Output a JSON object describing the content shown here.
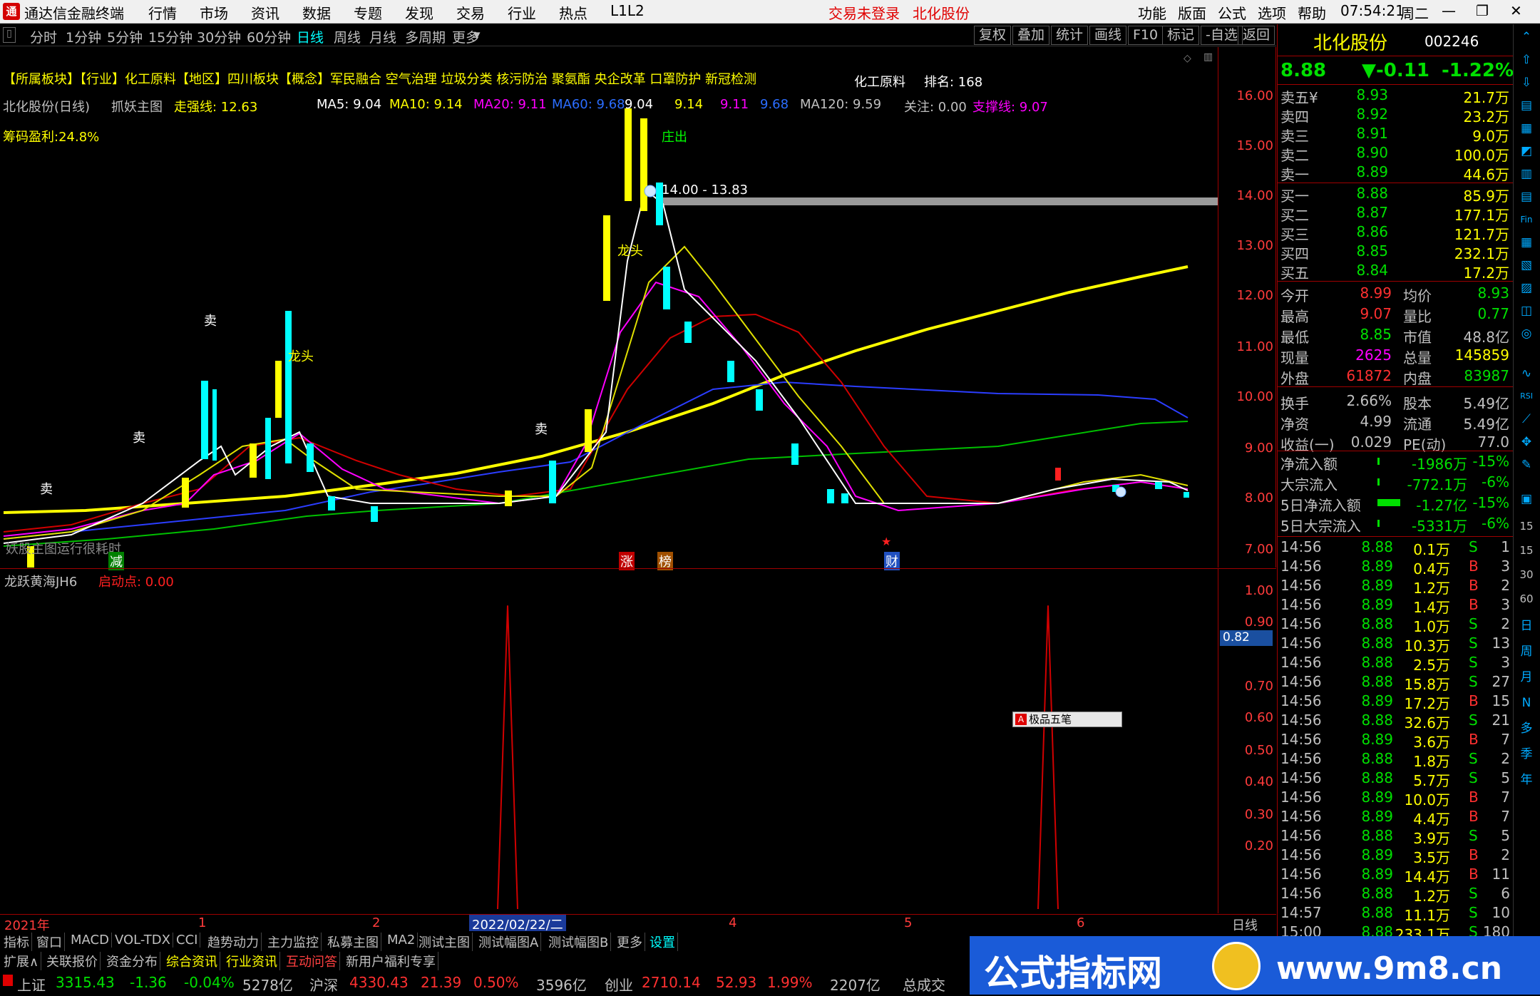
{
  "titlebar": {
    "app_name": "通达信金融终端",
    "menus": [
      "行情",
      "市场",
      "资讯",
      "数据",
      "专题",
      "发现",
      "交易",
      "行业",
      "热点",
      "L1L2"
    ],
    "login_status": "交易未登录",
    "stock_name": "北化股份",
    "right_menus": [
      "功能",
      "版面",
      "公式",
      "选项",
      "帮助"
    ],
    "time": "07:54:21",
    "weekday": "周二"
  },
  "periods": [
    "分时",
    "1分钟",
    "5分钟",
    "15分钟",
    "30分钟",
    "60分钟",
    "日线",
    "周线",
    "月线",
    "多周期",
    "更多"
  ],
  "selected_period": "日线",
  "toolbar_buttons": [
    "复权",
    "叠加",
    "统计",
    "画线",
    "F10",
    "标记",
    "-自选",
    "返回"
  ],
  "chart_header": {
    "title": "北化股份(日线)",
    "main_indicator": "抓妖主图",
    "zqx_label": "走强线: 12.63",
    "ma5": "MA5: 9.04",
    "ma10": "MA10: 9.14",
    "ma20": "MA20: 9.11",
    "ma60": "MA60: 9.68",
    "v1": "9.04",
    "v2": "9.14",
    "v3": "9.11",
    "v4": "9.68",
    "ma120": "MA120: 9.59",
    "guanzhu": "关注: 0.00",
    "zhicheng": "支撑线: 9.07"
  },
  "concepts": "【所属板块】【行业】化工原料【地区】四川板块【概念】军民融合 空气治理 垃圾分类 核污防治 聚氨酯 央企改革 口罩防护 新冠检测",
  "industry": "化工原料",
  "rank": "排名: 168",
  "chip_profit": "筹码盈利:24.8%",
  "zone_label": "14.00 - 13.83",
  "annotations": {
    "sell": "卖",
    "dragon_head": "龙头",
    "zhuang_out": "庄出",
    "jian": "减",
    "zhang": "涨",
    "bang": "榜",
    "cai": "财",
    "bottom_note": "妖股主图运行很耗时"
  },
  "y_axis_main": [
    "16.00",
    "15.00",
    "14.00",
    "13.00",
    "12.00",
    "11.00",
    "10.00",
    "9.00",
    "8.00",
    "7.00"
  ],
  "sub_chart": {
    "title": "龙跃黄海JH6",
    "start_label": "启动点: 0.00",
    "y_axis": [
      "1.00",
      "0.90",
      "0.80",
      "0.70",
      "0.60",
      "0.50",
      "0.40",
      "0.30",
      "0.20"
    ],
    "current_value": "0.82",
    "ime_popup": "极品五笔"
  },
  "chart_data": {
    "type": "line",
    "title": "龙跃黄海JH6",
    "ylim": [
      0,
      1.05
    ],
    "series": [
      {
        "name": "启动点",
        "peaks_at_dates": [
          "2022/02/22",
          "2022/06"
        ],
        "values": [
          0,
          1,
          0,
          1,
          0
        ]
      }
    ]
  },
  "date_axis": {
    "year": "2021年",
    "m1": "1",
    "m2": "2",
    "highlight": "2022/02/22/二",
    "m4": "4",
    "m5": "5",
    "m6": "6",
    "right": "日线"
  },
  "bottom_tabs": [
    "指标",
    "窗口",
    "MACD",
    "VOL-TDX",
    "CCI",
    "趋势动力",
    "主力监控",
    "私募主图",
    "MA2",
    "测试主图",
    "测试幅图A",
    "测试幅图B",
    "更多",
    "设置"
  ],
  "bottom_tabs2": [
    "扩展∧",
    "关联报价",
    "资金分布",
    "综合资讯",
    "行业资讯",
    "互动问答",
    "新用户福利专享"
  ],
  "status": {
    "sh_label": "上证",
    "sh_val": "3315.43",
    "sh_chg": "-1.36",
    "sh_pct": "-0.04%",
    "sh_amt": "5278亿",
    "hs_label": "沪深",
    "hs_val": "4330.43",
    "hs_chg": "21.39",
    "hs_pct": "0.50%",
    "hs_amt": "3596亿",
    "cy_label": "创业",
    "cy_val": "2710.14",
    "cy_chg": "52.93",
    "cy_pct": "1.99%",
    "cy_amt": "2207亿",
    "total": "总成交"
  },
  "quote": {
    "name": "北化股份",
    "code": "002246",
    "price": "8.88",
    "change": "▼-0.11",
    "pct": "-1.22%",
    "asks": [
      [
        "卖五¥",
        "8.93",
        "21.7万"
      ],
      [
        "卖四",
        "8.92",
        "23.2万"
      ],
      [
        "卖三",
        "8.91",
        "9.0万"
      ],
      [
        "卖二",
        "8.90",
        "100.0万"
      ],
      [
        "卖一",
        "8.89",
        "44.6万"
      ]
    ],
    "bids": [
      [
        "买一",
        "8.88",
        "85.9万"
      ],
      [
        "买二",
        "8.87",
        "177.1万"
      ],
      [
        "买三",
        "8.86",
        "121.7万"
      ],
      [
        "买四",
        "8.85",
        "232.1万"
      ],
      [
        "买五",
        "8.84",
        "17.2万"
      ]
    ],
    "stats": [
      [
        "今开",
        "8.99",
        "均价",
        "8.93"
      ],
      [
        "最高",
        "9.07",
        "量比",
        "0.77"
      ],
      [
        "最低",
        "8.85",
        "市值",
        "48.8亿"
      ],
      [
        "现量",
        "2625",
        "总量",
        "145859"
      ],
      [
        "外盘",
        "61872",
        "内盘",
        "83987"
      ],
      [
        "换手",
        "2.66%",
        "股本",
        "5.49亿"
      ],
      [
        "净资",
        "4.99",
        "流通",
        "5.49亿"
      ],
      [
        "收益(一)",
        "0.029",
        "PE(动)",
        "77.0"
      ]
    ],
    "flows": [
      [
        "净流入额",
        "-1986万",
        "-15%"
      ],
      [
        "大宗流入",
        "-772.1万",
        "-6%"
      ],
      [
        "5日净流入额",
        "-1.27亿",
        "-15%"
      ],
      [
        "5日大宗流入",
        "-5331万",
        "-6%"
      ]
    ],
    "ticks": [
      [
        "14:56",
        "8.88",
        "0.1万",
        "S",
        "1"
      ],
      [
        "14:56",
        "8.89",
        "0.4万",
        "B",
        "3"
      ],
      [
        "14:56",
        "8.89",
        "1.2万",
        "B",
        "2"
      ],
      [
        "14:56",
        "8.89",
        "1.4万",
        "B",
        "3"
      ],
      [
        "14:56",
        "8.88",
        "1.0万",
        "S",
        "2"
      ],
      [
        "14:56",
        "8.88",
        "10.3万",
        "S",
        "13"
      ],
      [
        "14:56",
        "8.88",
        "2.5万",
        "S",
        "3"
      ],
      [
        "14:56",
        "8.88",
        "15.8万",
        "S",
        "27"
      ],
      [
        "14:56",
        "8.89",
        "17.2万",
        "B",
        "15"
      ],
      [
        "14:56",
        "8.88",
        "32.6万",
        "S",
        "21"
      ],
      [
        "14:56",
        "8.89",
        "3.6万",
        "B",
        "7"
      ],
      [
        "14:56",
        "8.88",
        "1.8万",
        "S",
        "2"
      ],
      [
        "14:56",
        "8.88",
        "5.7万",
        "S",
        "5"
      ],
      [
        "14:56",
        "8.89",
        "10.0万",
        "B",
        "7"
      ],
      [
        "14:56",
        "8.89",
        "4.4万",
        "B",
        "7"
      ],
      [
        "14:56",
        "8.88",
        "3.9万",
        "S",
        "5"
      ],
      [
        "14:56",
        "8.89",
        "3.5万",
        "B",
        "2"
      ],
      [
        "14:56",
        "8.89",
        "14.4万",
        "B",
        "11"
      ],
      [
        "14:56",
        "8.88",
        "1.2万",
        "S",
        "6"
      ],
      [
        "14:57",
        "8.88",
        "11.1万",
        "S",
        "10"
      ],
      [
        "15:00",
        "8.88",
        "233.1万",
        "S",
        "180"
      ]
    ]
  },
  "tool_col": [
    "15",
    "30",
    "60",
    "日",
    "周",
    "月",
    "N",
    "多",
    "季",
    "年"
  ],
  "watermark": {
    "text": "公式指标网",
    "url": "www.9m8.cn"
  }
}
